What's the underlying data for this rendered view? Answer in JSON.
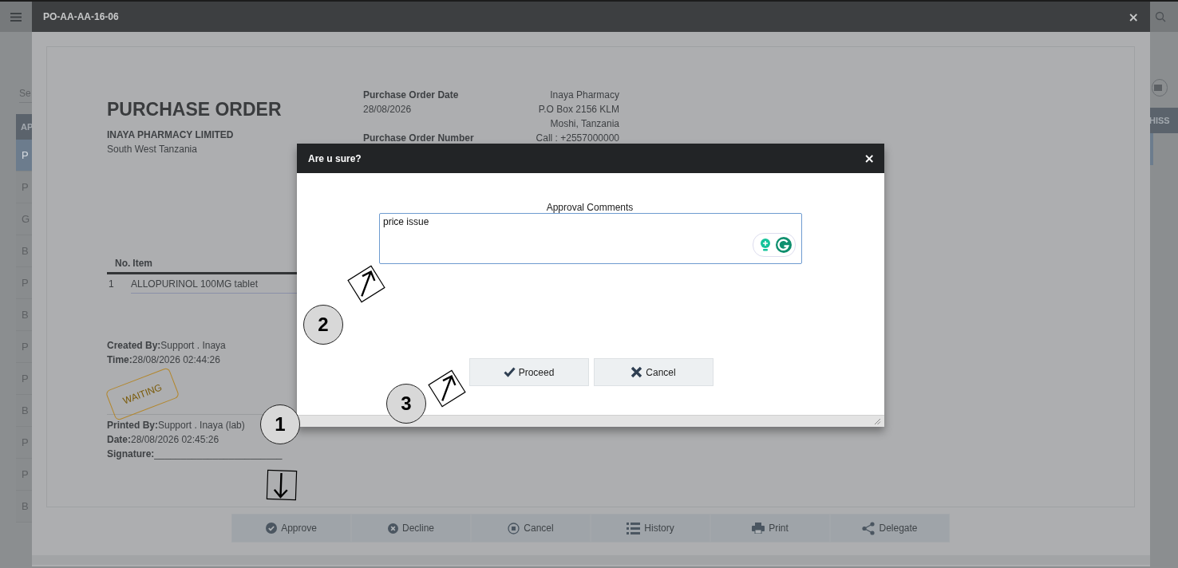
{
  "background_page": {
    "search": {
      "placeholder": "Se"
    },
    "list_header": "AP",
    "list_rows": [
      {
        "label": "P",
        "selected": true
      },
      {
        "label": "P",
        "selected": false
      },
      {
        "label": "G",
        "selected": false
      },
      {
        "label": "B",
        "selected": false
      },
      {
        "label": "P",
        "selected": false
      },
      {
        "label": "B",
        "selected": false
      },
      {
        "label": "P",
        "selected": false
      },
      {
        "label": "P",
        "selected": false
      },
      {
        "label": "B",
        "selected": false
      },
      {
        "label": "P",
        "selected": false
      },
      {
        "label": "P",
        "selected": false
      },
      {
        "label": "B",
        "selected": false
      }
    ],
    "right_header": "HISS"
  },
  "window": {
    "title": "PO-AA-AA-16-06",
    "close": "×"
  },
  "document": {
    "title": "PURCHASE ORDER",
    "company": "INAYA PHARMACY LIMITED",
    "region": "South West Tanzania",
    "meta": [
      {
        "label": "Purchase Order Date",
        "value": "28/08/2026"
      },
      {
        "label": "Purchase Order Number"
      }
    ],
    "address": [
      "Inaya Pharmacy",
      "P.O Box 2156 KLM",
      "Moshi, Tanzania",
      "Call : +2557000000"
    ],
    "table": {
      "columns": [
        "No.",
        "Item"
      ],
      "rows": [
        [
          "1",
          "ALLOPURINOL 100MG tablet"
        ]
      ]
    },
    "created": [
      "**Created By:**Support . Inaya",
      "**Time:**28/08/2026 02:44:26"
    ],
    "stamp": "WAITING",
    "printed": [
      "**Printed By:**Support . Inaya (lab)",
      "**Date:**28/08/2026 02:45:26",
      "**Signature:**________________________"
    ]
  },
  "actions": [
    "Approve",
    "Decline",
    "Cancel",
    "History",
    "Print",
    "Delegate"
  ],
  "dialog": {
    "title": "Are u sure?",
    "close": "×",
    "field_label": "Approval Comments",
    "value": "price issue",
    "buttons": [
      "Proceed",
      "Cancel"
    ]
  },
  "annotations": [
    {
      "label": "1"
    },
    {
      "label": "2"
    },
    {
      "label": "3"
    }
  ]
}
